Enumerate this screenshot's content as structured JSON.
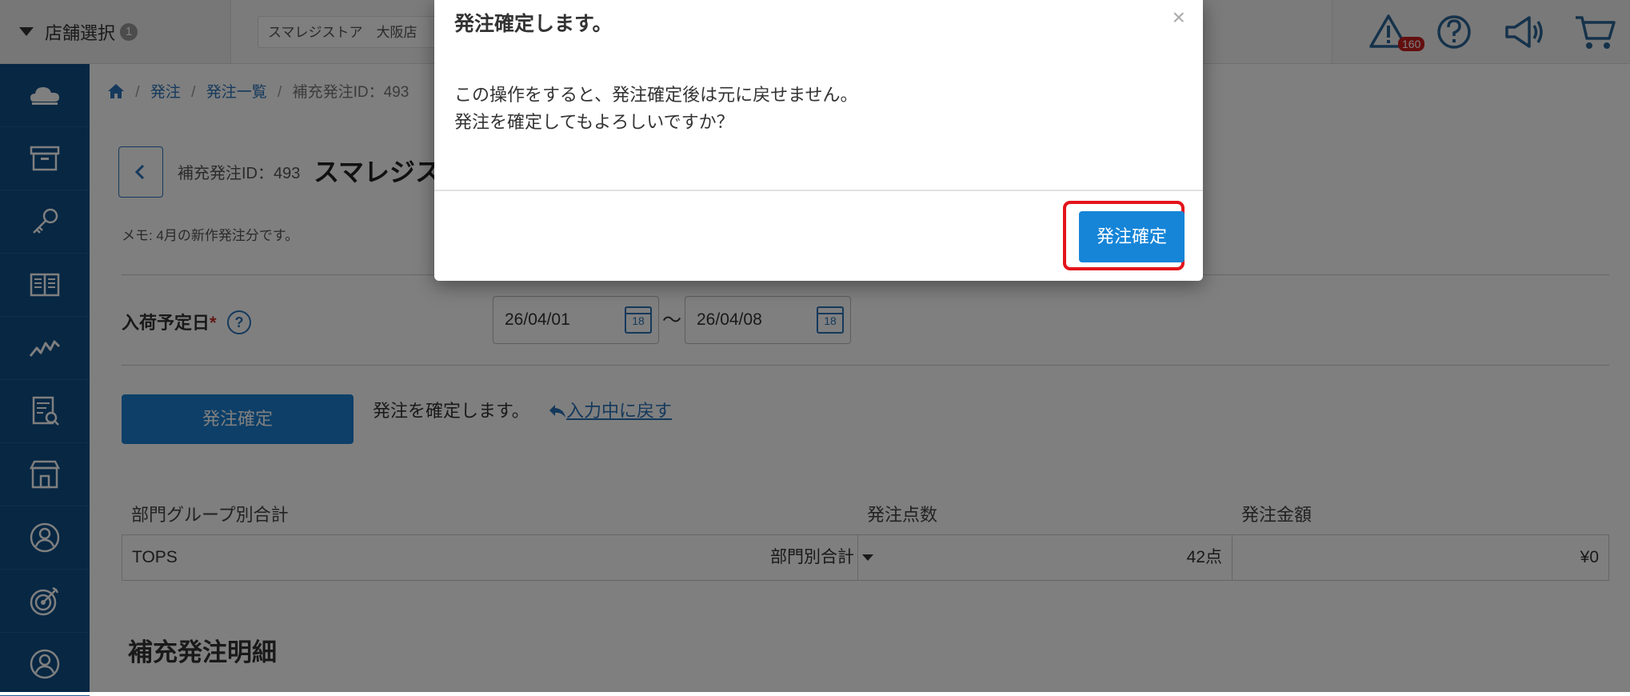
{
  "header": {
    "store_select_label": "店舗選択",
    "store_select_count": "1",
    "store_name": "スマレジストア　大阪店",
    "alert_count": "160"
  },
  "icons": {
    "sidebar": [
      "cloud-icon",
      "archive-icon",
      "key-icon",
      "book-icon",
      "chart-line-icon",
      "receipt-search-icon",
      "store-icon",
      "staff-icon",
      "target-icon",
      "user-icon"
    ],
    "top": [
      "alert-icon",
      "help-icon",
      "megaphone-icon",
      "cart-icon"
    ]
  },
  "breadcrumb": {
    "home": "",
    "order": "発注",
    "order_list": "発注一覧",
    "current": "補充発注ID：493"
  },
  "page": {
    "order_id": "補充発注ID：493",
    "title": "スマレジス",
    "memo": "メモ: 4月の新作発注分です。",
    "arrival_label": "入荷予定日",
    "required_mark": "*",
    "help": "?",
    "date_from": "26/04/01",
    "date_to": "26/04/08",
    "calendar_day": "18",
    "tilde": "〜",
    "confirm_button": "発注確定",
    "confirm_text": "発注を確定します。",
    "revert_link": "入力中に戻す",
    "table": {
      "headers": [
        "部門グループ別合計",
        "発注点数",
        "発注金額"
      ],
      "row": {
        "group": "TOPS",
        "dept_select": "部門別合計",
        "qty": "42点",
        "amount": "¥0"
      }
    },
    "section_title": "補充発注明細"
  },
  "modal": {
    "title": "発注確定します。",
    "close": "×",
    "body_line1": "この操作をすると、発注確定後は元に戻せません。",
    "body_line2": "発注を確定してもよろしいですか？",
    "confirm_button": "発注確定"
  },
  "colors": {
    "sidebar": "#0f4f86",
    "primary": "#1685d8",
    "highlight": "#e3141b"
  }
}
